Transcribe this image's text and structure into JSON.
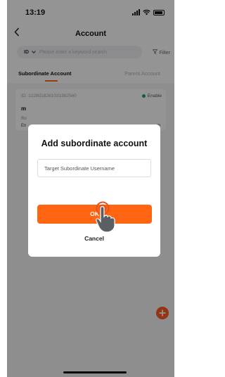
{
  "status_bar": {
    "time": "13:19"
  },
  "nav": {
    "back_icon": "chevron-left-icon",
    "title": "Account"
  },
  "search": {
    "field_selector": "ID",
    "placeholder": "Please enter a keyword search",
    "filter_label": "Filter"
  },
  "tabs": [
    {
      "label": "Subordinate Account",
      "active": true
    },
    {
      "label": "Parent Account",
      "active": false
    }
  ],
  "account_card": {
    "id_label": "ID: 1228018261031362560",
    "status": "Enable",
    "status_color": "#21a35b",
    "name_partial": "m",
    "role_partial": "Ro",
    "email_partial_left": "En",
    "email_partial_right": "m"
  },
  "dialog": {
    "title": "Add subordinate account",
    "input_placeholder": "Target Subordinate Username",
    "input_value": "",
    "ok_label": "OK",
    "cancel_label": "Cancel"
  },
  "fab": {
    "icon": "plus-icon"
  },
  "colors": {
    "accent": "#ff6512",
    "fab": "#ff5a1f",
    "indicator": "#ff6b1a"
  }
}
